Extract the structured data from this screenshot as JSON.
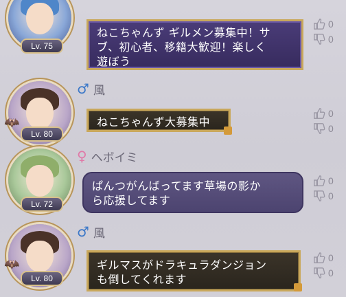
{
  "messages": [
    {
      "username": "",
      "level": "Lv. 75",
      "text_line1": "ねこちゃんず ギルメン募集中！サ",
      "text_line2": "ブ、初心者、移籍大歓迎！楽しく",
      "text_line3": "遊ぼう",
      "likes": "0",
      "dislikes": "0"
    },
    {
      "username": "風",
      "level": "Lv. 80",
      "text_line1": "ねこちゃんず大募集中",
      "likes": "0",
      "dislikes": "0"
    },
    {
      "username": "ヘボイミ",
      "level": "Lv. 72",
      "text_line1": "ぱんつがんばってます草場の影か",
      "text_line2": "ら応援してます",
      "likes": "0",
      "dislikes": "0"
    },
    {
      "username": "風",
      "level": "Lv. 80",
      "text_line1": "ギルマスがドラキュラダンジョン",
      "text_line2": "も倒してくれます",
      "likes": "0",
      "dislikes": "0"
    }
  ],
  "icons": [
    "thumbs-up-icon",
    "thumbs-down-icon",
    "male-icon",
    "female-icon"
  ],
  "colors": {
    "bubble_border": "#c9a85b",
    "purple_bubble": "#3f3268",
    "dark_bubble": "#322c22",
    "violet_bubble": "#564d7a"
  }
}
